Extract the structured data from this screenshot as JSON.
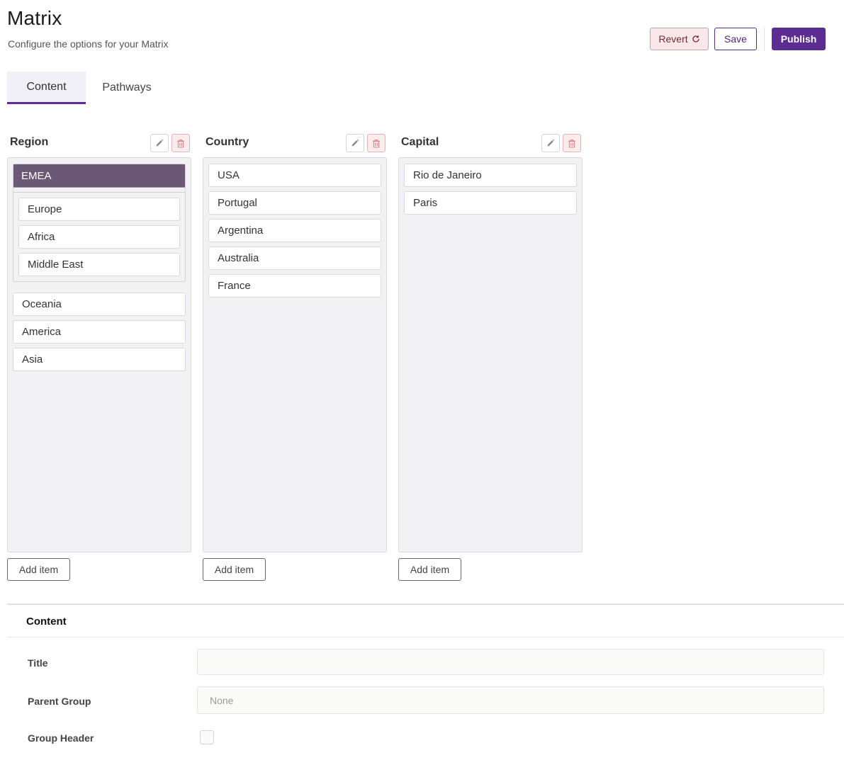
{
  "header": {
    "title": "Matrix",
    "subtitle": "Configure the options for your Matrix"
  },
  "actions": {
    "revert_label": "Revert",
    "save_label": "Save",
    "publish_label": "Publish"
  },
  "tabs": [
    {
      "label": "Content",
      "active": true
    },
    {
      "label": "Pathways",
      "active": false
    }
  ],
  "columns": [
    {
      "title": "Region",
      "group": {
        "label": "EMEA",
        "items": [
          "Europe",
          "Africa",
          "Middle East"
        ]
      },
      "items": [
        "Oceania",
        "America",
        "Asia"
      ],
      "add_label": "Add item"
    },
    {
      "title": "Country",
      "items": [
        "USA",
        "Portugal",
        "Argentina",
        "Australia",
        "France"
      ],
      "add_label": "Add item"
    },
    {
      "title": "Capital",
      "items": [
        "Rio de Janeiro",
        "Paris"
      ],
      "add_label": "Add item"
    }
  ],
  "content_section": {
    "title": "Content",
    "fields": {
      "title_label": "Title",
      "title_value": "",
      "parent_group_label": "Parent Group",
      "parent_group_placeholder": "None",
      "group_header_label": "Group Header",
      "group_header_checked": false
    }
  },
  "colors": {
    "accent": "#5b2c91",
    "group_header": "#6b5876",
    "revert_bg": "#f8e8e9"
  }
}
